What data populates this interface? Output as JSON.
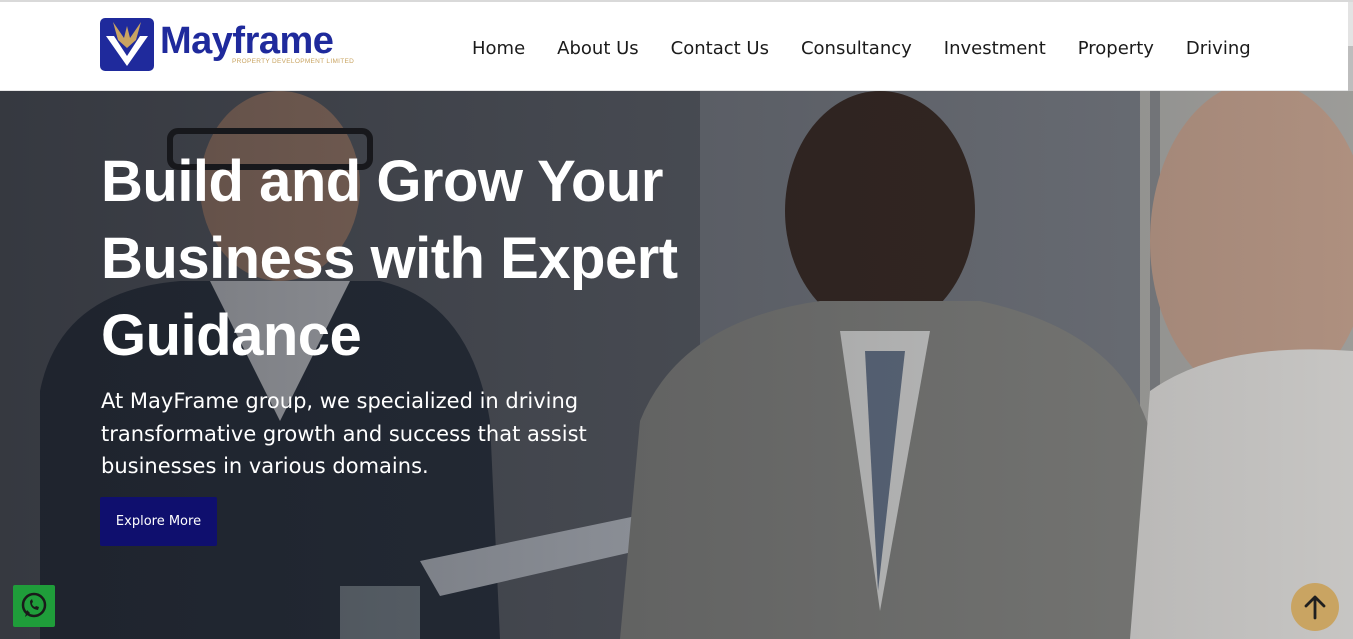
{
  "brand": {
    "name": "Mayframe",
    "tagline": "PROPERTY DEVELOPMENT LIMITED",
    "primary_color": "#1f2a9c",
    "accent_color": "#c9a462"
  },
  "nav": {
    "items": [
      {
        "label": "Home"
      },
      {
        "label": "About Us"
      },
      {
        "label": "Contact Us"
      },
      {
        "label": "Consultancy"
      },
      {
        "label": "Investment"
      },
      {
        "label": "Property"
      },
      {
        "label": "Driving"
      }
    ]
  },
  "hero": {
    "title": "Build and Grow Your Business with Expert Guidance",
    "text": "At MayFrame group, we specialized in driving transformative growth and success that assist businesses in various domains.",
    "button_label": "Explore More",
    "button_color": "#0f0f6e",
    "image": "business-meeting-photo"
  },
  "floating": {
    "whatsapp_icon": "whatsapp-icon",
    "whatsapp_color": "#1f9d3a",
    "scroll_top_icon": "arrow-up-icon",
    "scroll_top_color": "#c9a462"
  }
}
